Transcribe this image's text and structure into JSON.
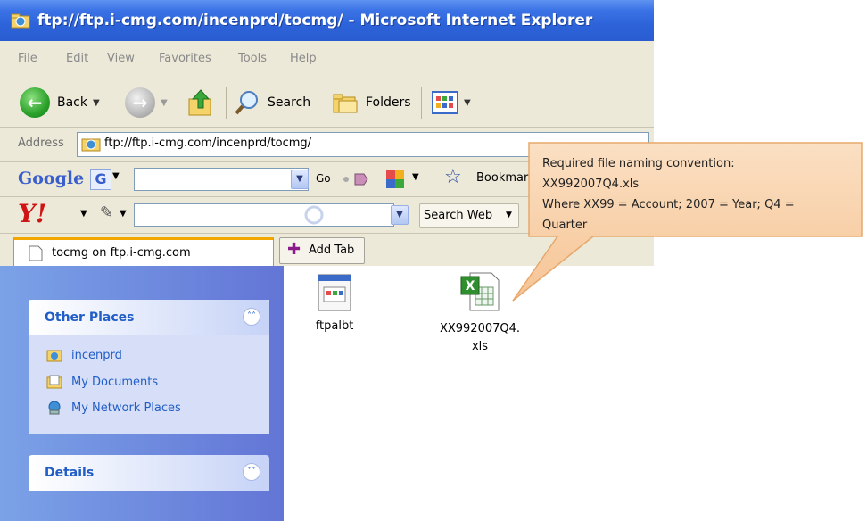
{
  "window": {
    "title": "ftp://ftp.i-cmg.com/incenprd/tocmg/ - Microsoft Internet Explorer"
  },
  "menu": [
    "File",
    "Edit",
    "View",
    "Favorites",
    "Tools",
    "Help"
  ],
  "toolbar": {
    "back_label": "Back",
    "search_label": "Search",
    "folders_label": "Folders"
  },
  "address": {
    "label": "Address",
    "url": "ftp://ftp.i-cmg.com/incenprd/tocmg/"
  },
  "google_bar": {
    "logo": "Google",
    "g_label": "G",
    "go_label": "Go",
    "bookmarks_label": "Bookmar"
  },
  "yahoo_bar": {
    "logo": "Y!",
    "search_web_label": "Search Web"
  },
  "tabs": {
    "active_tab": "tocmg on ftp.i-cmg.com",
    "add_tab_label": "Add Tab"
  },
  "sidebar": {
    "other_places": {
      "title": "Other Places",
      "items": [
        {
          "label": "incenprd",
          "icon": "ftp-folder-icon"
        },
        {
          "label": "My Documents",
          "icon": "my-documents-icon"
        },
        {
          "label": "My Network Places",
          "icon": "network-places-icon"
        }
      ]
    },
    "details": {
      "title": "Details"
    }
  },
  "files": [
    {
      "name": "ftpalbt",
      "icon": "application-file-icon"
    },
    {
      "name_line1": "XX992007Q4.",
      "name_line2": "xls",
      "icon": "excel-file-icon"
    }
  ],
  "callout": {
    "line1": "Required file naming convention:",
    "line2": "XX992007Q4.xls",
    "line3": "Where XX99 = Account; 2007 = Year; Q4 =",
    "line4": "Quarter",
    "fill": "#f7cda3",
    "border": "#e6a86c"
  },
  "colors": {
    "titlebar": "#2d63d9",
    "chrome": "#ece9d8",
    "sidebar": "#6f8ee0",
    "link": "#215dc6"
  }
}
